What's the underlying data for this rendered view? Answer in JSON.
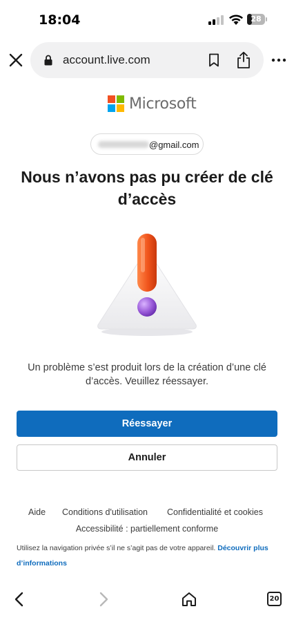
{
  "status": {
    "time": "18:04",
    "battery": "28",
    "battery_level": 0.28
  },
  "browser": {
    "url": "account.live.com"
  },
  "brand": {
    "name": "Microsoft",
    "colors": [
      "#f25022",
      "#7fba00",
      "#00a4ef",
      "#ffb900"
    ]
  },
  "identity": {
    "email_suffix": "@gmail.com"
  },
  "page": {
    "heading": "Nous n’avons pas pu créer de clé d’accès",
    "message": "Un problème s’est produit lors de la création d’une clé d’accès. Veuillez réessayer.",
    "retry_label": "Réessayer",
    "cancel_label": "Annuler",
    "illustration_icon": "warning-triangle-icon"
  },
  "footer": {
    "help": "Aide",
    "terms": "Conditions d'utilisation",
    "privacy": "Confidentialité et cookies",
    "accessibility": "Accessibilité : partiellement conforme",
    "private_note": "Utilisez la navigation privée s’il ne s’agit pas de votre appareil.",
    "private_link": "Découvrir plus d’informations"
  },
  "toolbar": {
    "tab_count": "20"
  },
  "colors": {
    "accent": "#0f6cbd",
    "exclamation": "#f0541c",
    "dot": "#9a5bd9"
  }
}
